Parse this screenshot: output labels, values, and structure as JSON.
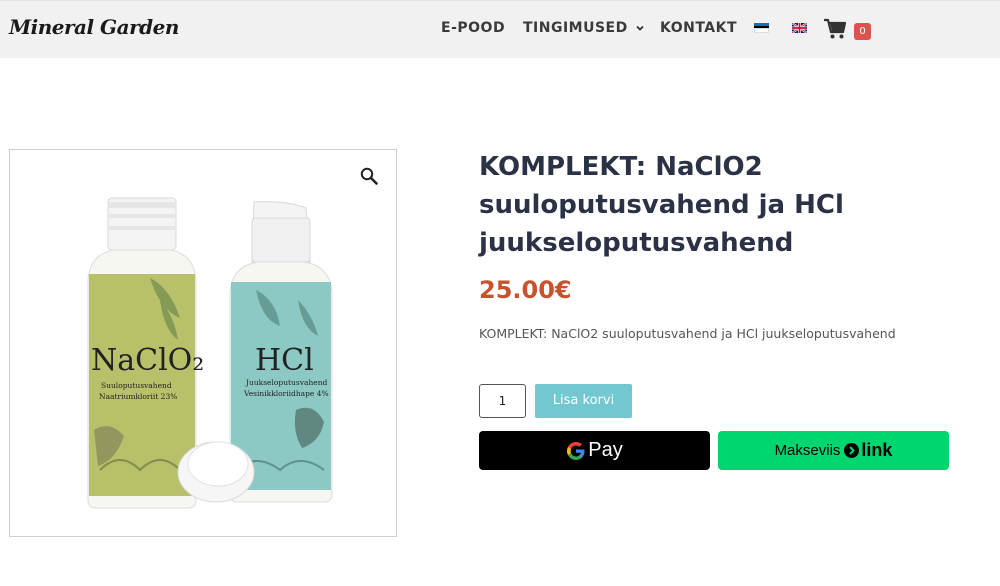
{
  "header": {
    "logo": "Mineral Garden",
    "nav": [
      {
        "label": "E-POOD"
      },
      {
        "label": "TINGIMUSED"
      },
      {
        "label": "KONTAKT"
      }
    ],
    "cart_count": "0"
  },
  "product": {
    "title": "KOMPLEKT: NaClO2 suuloputusvahend ja HCl juukseloputusvahend",
    "price": "25.00€",
    "short_description": "KOMPLEKT: NaClO2 suuloputusvahend ja HCl juukseloputusvahend",
    "quantity": "1",
    "add_to_cart_label": "Lisa korvi",
    "gpay_label": "Pay",
    "link_prefix": "Makseviis",
    "link_word": "link",
    "bottle1": {
      "name": "NaClO₂",
      "line1": "Suuloputusvahend",
      "line2": "Naatriumkloriit 23%"
    },
    "bottle2": {
      "name": "HCl",
      "line1": "Juukseloputusvahend",
      "line2": "Vesinikkloriidhape 4%"
    }
  },
  "colors": {
    "price": "#c9522d",
    "title": "#2b3245",
    "add_to_cart_bg": "#73c7d1",
    "link_bg": "#00d66f",
    "gpay_bg": "#000000"
  }
}
